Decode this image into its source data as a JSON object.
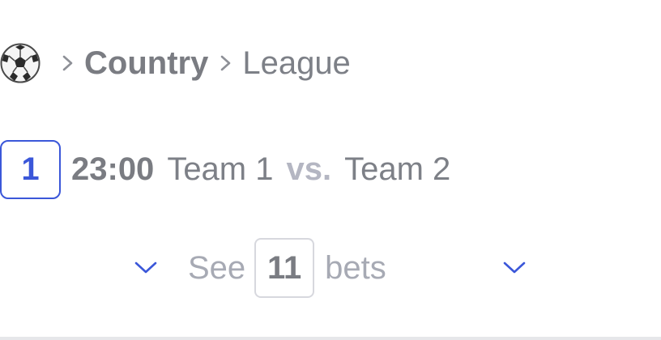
{
  "breadcrumb": {
    "sport_icon": "soccer-ball-icon",
    "separator_icon": "chevron-right-icon",
    "country": "Country",
    "league": "League"
  },
  "match": {
    "number": "1",
    "time": "23:00",
    "team1": "Team 1",
    "vs": "vs.",
    "team2": "Team 2"
  },
  "see_bets": {
    "prefix": "See",
    "count": "11",
    "suffix": "bets",
    "expand_icon": "chevron-down-icon"
  },
  "colors": {
    "accent": "#3b57d9",
    "text": "#7d8087",
    "muted": "#a7aab4",
    "vs": "#b4b6c2",
    "border": "#d7d8de"
  }
}
